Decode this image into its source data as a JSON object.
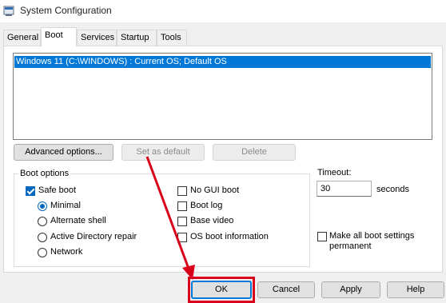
{
  "window": {
    "title": "System Configuration",
    "icon": "msconfig-icon"
  },
  "tabs": [
    {
      "label": "General"
    },
    {
      "label": "Boot"
    },
    {
      "label": "Services"
    },
    {
      "label": "Startup"
    },
    {
      "label": "Tools"
    }
  ],
  "os_list": {
    "items": [
      "Windows 11 (C:\\WINDOWS) : Current OS; Default OS"
    ]
  },
  "actions": {
    "advanced_options": "Advanced options...",
    "set_as_default": "Set as default",
    "delete": "Delete"
  },
  "boot_options": {
    "title": "Boot options",
    "safe_boot": "Safe boot",
    "minimal": "Minimal",
    "alternate_shell": "Alternate shell",
    "active_directory_repair": "Active Directory repair",
    "network": "Network",
    "no_gui_boot": "No GUI boot",
    "boot_log": "Boot log",
    "base_video": "Base video",
    "os_boot_information": "OS boot information"
  },
  "timeout": {
    "label": "Timeout:",
    "value": "30",
    "unit": "seconds"
  },
  "permanent": {
    "line1": "Make all boot settings",
    "line2": "permanent"
  },
  "footer": {
    "ok": "OK",
    "cancel": "Cancel",
    "apply": "Apply",
    "help": "Help"
  },
  "annotation": {
    "color": "#d9001b"
  }
}
